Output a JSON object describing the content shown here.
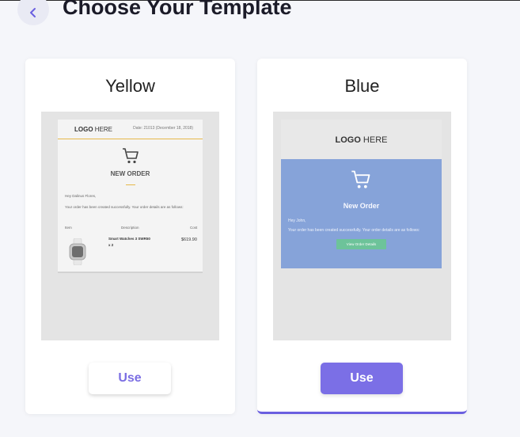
{
  "header": {
    "title": "Choose Your Template",
    "back_icon": "chevron-left-icon",
    "accent_color": "#6a5fe0"
  },
  "templates": [
    {
      "name": "Yellow",
      "use_label": "Use",
      "selected": false,
      "preview": {
        "logo_bold": "LOGO",
        "logo_light": " HERE",
        "date": "Date: 21013 (December 18, 2018)",
        "heading": "NEW ORDER",
        "greeting": "Hey Dalinus Flores,",
        "message": "Your order has been created successfully. Your order details are as follows:",
        "col_item": "Item",
        "col_description": "Description",
        "col_cost": "Cost",
        "product": "Smart Watches 3 SWR50",
        "quantity": "x 2",
        "price": "$619.90",
        "accent_color": "#e6b84a"
      }
    },
    {
      "name": "Blue",
      "use_label": "Use",
      "selected": true,
      "preview": {
        "logo_bold": "LOGO",
        "logo_light": " HERE",
        "heading": "New Order",
        "greeting": "Hey John,",
        "message": "Your order has been created successfully. Your order details are as follows:",
        "button": "View Order Details",
        "accent_color": "#86a3d9"
      }
    }
  ]
}
